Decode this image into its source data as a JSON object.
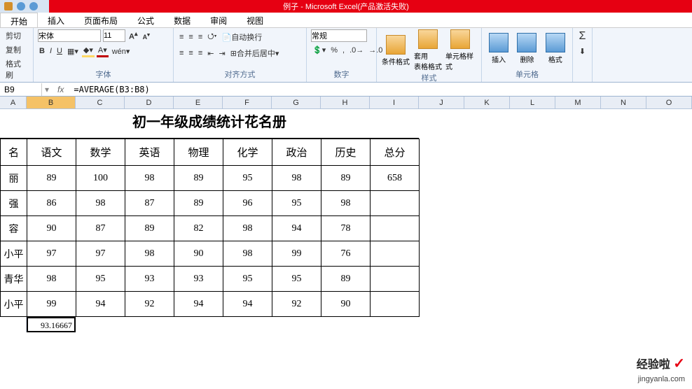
{
  "app": {
    "title": "例子 - Microsoft Excel(产品激活失败)"
  },
  "tabs": {
    "t0": "开始",
    "t1": "插入",
    "t2": "页面布局",
    "t3": "公式",
    "t4": "数据",
    "t5": "审阅",
    "t6": "视图"
  },
  "clip": {
    "cut": "剪切",
    "copy": "复制",
    "brush": "格式刷"
  },
  "font": {
    "family": "宋体",
    "size": "11",
    "grow": "A",
    "shrink": "A",
    "b": "B",
    "i": "I",
    "u": "U",
    "label": "字体"
  },
  "align": {
    "wrap": "自动换行",
    "merge": "合并后居中",
    "label": "对齐方式"
  },
  "number": {
    "format": "常规",
    "label": "数字"
  },
  "styles": {
    "cond": "条件格式",
    "table": "套用\n表格格式",
    "cell": "单元格样式",
    "label": "样式"
  },
  "cells": {
    "ins": "插入",
    "del": "删除",
    "fmt": "格式",
    "label": "单元格"
  },
  "namebox": "B9",
  "formula": "=AVERAGE(B3:B8)",
  "cols": [
    "A",
    "B",
    "C",
    "D",
    "E",
    "F",
    "G",
    "H",
    "I",
    "J",
    "K",
    "L",
    "M",
    "N",
    "O"
  ],
  "sheet_title": "初一年级成绩统计花名册",
  "headers": [
    "名",
    "语文",
    "数学",
    "英语",
    "物理",
    "化学",
    "政治",
    "历史",
    "总分"
  ],
  "rows": [
    {
      "name": "丽",
      "v": [
        "89",
        "100",
        "98",
        "89",
        "95",
        "98",
        "89",
        "658"
      ]
    },
    {
      "name": "强",
      "v": [
        "86",
        "98",
        "87",
        "89",
        "96",
        "95",
        "98",
        ""
      ]
    },
    {
      "name": "容",
      "v": [
        "90",
        "87",
        "89",
        "82",
        "98",
        "94",
        "78",
        ""
      ]
    },
    {
      "name": "小平",
      "v": [
        "97",
        "97",
        "98",
        "90",
        "98",
        "99",
        "76",
        ""
      ]
    },
    {
      "name": "青华",
      "v": [
        "98",
        "95",
        "93",
        "93",
        "95",
        "95",
        "89",
        ""
      ]
    },
    {
      "name": "小平",
      "v": [
        "99",
        "94",
        "92",
        "94",
        "94",
        "92",
        "90",
        ""
      ]
    }
  ],
  "result_cell": "93.16667",
  "watermark": {
    "text": "经验啦",
    "url": "jingyanla.com"
  },
  "chart_data": {
    "type": "table",
    "title": "初一年级成绩统计花名册",
    "columns": [
      "名",
      "语文",
      "数学",
      "英语",
      "物理",
      "化学",
      "政治",
      "历史",
      "总分"
    ],
    "data": [
      [
        "丽",
        89,
        100,
        98,
        89,
        95,
        98,
        89,
        658
      ],
      [
        "强",
        86,
        98,
        87,
        89,
        96,
        95,
        98,
        null
      ],
      [
        "容",
        90,
        87,
        89,
        82,
        98,
        94,
        78,
        null
      ],
      [
        "小平",
        97,
        97,
        98,
        90,
        98,
        99,
        76,
        null
      ],
      [
        "青华",
        98,
        95,
        93,
        93,
        95,
        95,
        89,
        null
      ],
      [
        "小平",
        99,
        94,
        92,
        94,
        94,
        92,
        90,
        null
      ]
    ],
    "average_B3_B8": 93.16667
  }
}
